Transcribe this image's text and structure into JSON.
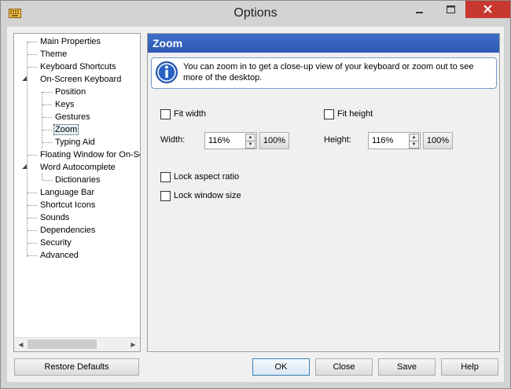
{
  "window": {
    "title": "Options"
  },
  "tree": {
    "items": [
      {
        "label": "Main Properties"
      },
      {
        "label": "Theme"
      },
      {
        "label": "Keyboard Shortcuts"
      },
      {
        "label": "On-Screen Keyboard"
      },
      {
        "label": "Position"
      },
      {
        "label": "Keys"
      },
      {
        "label": "Gestures"
      },
      {
        "label": "Zoom"
      },
      {
        "label": "Typing Aid"
      },
      {
        "label": "Floating Window for On-Scre"
      },
      {
        "label": "Word Autocomplete"
      },
      {
        "label": "Dictionaries"
      },
      {
        "label": "Language Bar"
      },
      {
        "label": "Shortcut Icons"
      },
      {
        "label": "Sounds"
      },
      {
        "label": "Dependencies"
      },
      {
        "label": "Security"
      },
      {
        "label": "Advanced"
      }
    ],
    "selected": "Zoom"
  },
  "panel": {
    "title": "Zoom",
    "info": "You can zoom in to get a close-up view of your keyboard or zoom out to see more of the desktop.",
    "fit_width": "Fit width",
    "fit_height": "Fit height",
    "width_label": "Width:",
    "width_value": "116%",
    "width_reset": "100%",
    "height_label": "Height:",
    "height_value": "116%",
    "height_reset": "100%",
    "lock_aspect": "Lock aspect ratio",
    "lock_window": "Lock window size"
  },
  "footer": {
    "restore": "Restore Defaults",
    "ok": "OK",
    "close": "Close",
    "save": "Save",
    "help": "Help"
  },
  "icons": {
    "app": "keyboard-icon",
    "info": "info-icon"
  },
  "colors": {
    "header": "#2f59b3",
    "close_btn": "#c7382f"
  }
}
